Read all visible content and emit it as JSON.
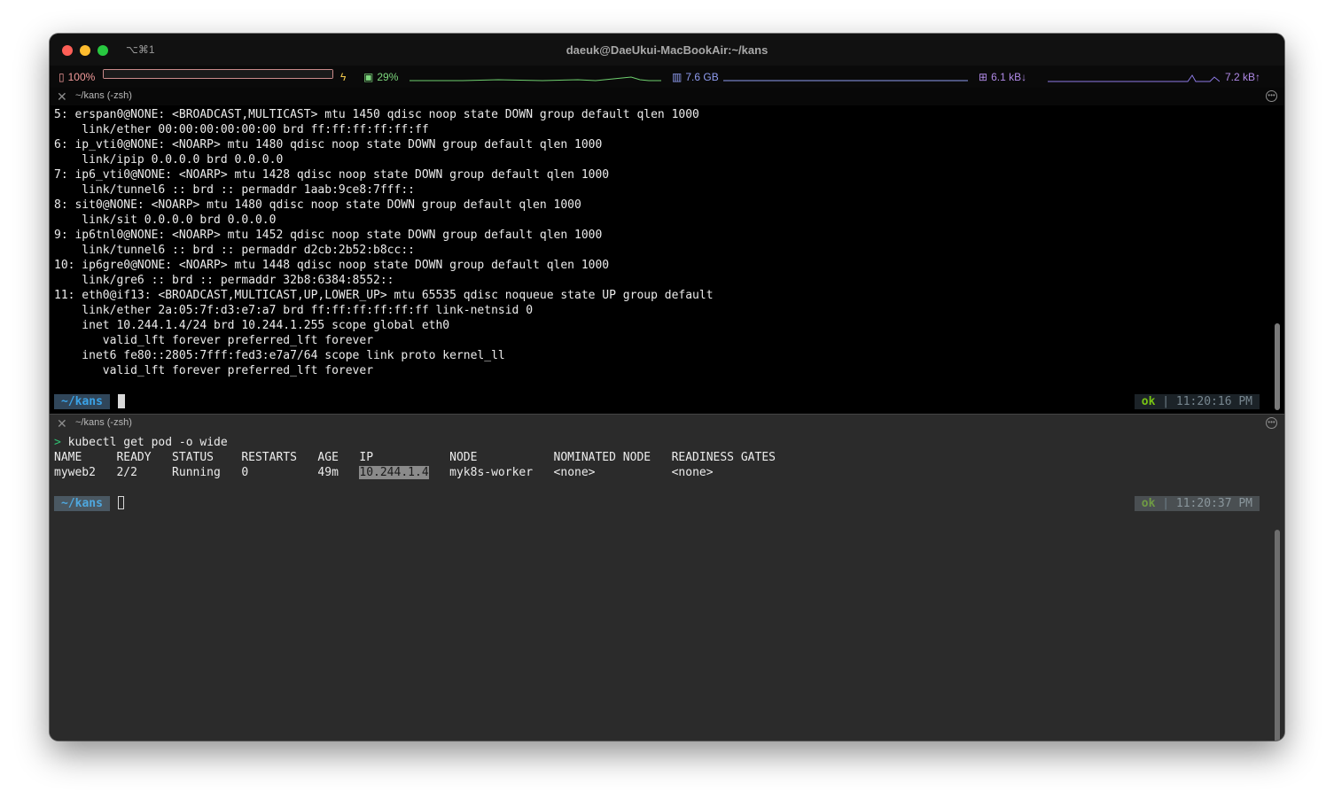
{
  "window": {
    "shortcut": "⌥⌘1",
    "title": "daeuk@DaeUkui-MacBookAir:~/kans"
  },
  "statusbar": {
    "battery": "100%",
    "cpu": "29%",
    "memory": "7.6 GB",
    "net_down": "6.1 kB↓",
    "net_up": "7.2 kB↑",
    "battery_level": 1.0,
    "colors": {
      "battery": "#f29a9a",
      "cpu": "#7dd87d",
      "memory": "#8f9cf0",
      "network": "#b089e6"
    }
  },
  "pane_top": {
    "header": "~/kans (-zsh)",
    "lines": [
      "5: erspan0@NONE: <BROADCAST,MULTICAST> mtu 1450 qdisc noop state DOWN group default qlen 1000",
      "    link/ether 00:00:00:00:00:00 brd ff:ff:ff:ff:ff:ff",
      "6: ip_vti0@NONE: <NOARP> mtu 1480 qdisc noop state DOWN group default qlen 1000",
      "    link/ipip 0.0.0.0 brd 0.0.0.0",
      "7: ip6_vti0@NONE: <NOARP> mtu 1428 qdisc noop state DOWN group default qlen 1000",
      "    link/tunnel6 :: brd :: permaddr 1aab:9ce8:7fff::",
      "8: sit0@NONE: <NOARP> mtu 1480 qdisc noop state DOWN group default qlen 1000",
      "    link/sit 0.0.0.0 brd 0.0.0.0",
      "9: ip6tnl0@NONE: <NOARP> mtu 1452 qdisc noop state DOWN group default qlen 1000",
      "    link/tunnel6 :: brd :: permaddr d2cb:2b52:b8cc::",
      "10: ip6gre0@NONE: <NOARP> mtu 1448 qdisc noop state DOWN group default qlen 1000",
      "    link/gre6 :: brd :: permaddr 32b8:6384:8552::",
      "11: eth0@if13: <BROADCAST,MULTICAST,UP,LOWER_UP> mtu 65535 qdisc noqueue state UP group default",
      "    link/ether 2a:05:7f:d3:e7:a7 brd ff:ff:ff:ff:ff:ff link-netnsid 0",
      "    inet 10.244.1.4/24 brd 10.244.1.255 scope global eth0",
      "       valid_lft forever preferred_lft forever",
      "    inet6 fe80::2805:7fff:fed3:e7a7/64 scope link proto kernel_ll",
      "       valid_lft forever preferred_lft forever"
    ],
    "prompt": "~/kans",
    "status_ok": "ok",
    "status_sep": "|",
    "time": "11:20:16 PM"
  },
  "pane_bottom": {
    "header": "~/kans (-zsh)",
    "command_marker": ">",
    "command": "kubectl get pod -o wide",
    "table_header": "NAME     READY   STATUS    RESTARTS   AGE   IP           NODE           NOMINATED NODE   READINESS GATES",
    "row_prefix": "myweb2   2/2     Running   0          49m   ",
    "row_ip": "10.244.1.4",
    "row_suffix": "   myk8s-worker   <none>           <none>",
    "prompt": "~/kans",
    "status_ok": "ok",
    "status_sep": "|",
    "time": "11:20:37 PM"
  }
}
